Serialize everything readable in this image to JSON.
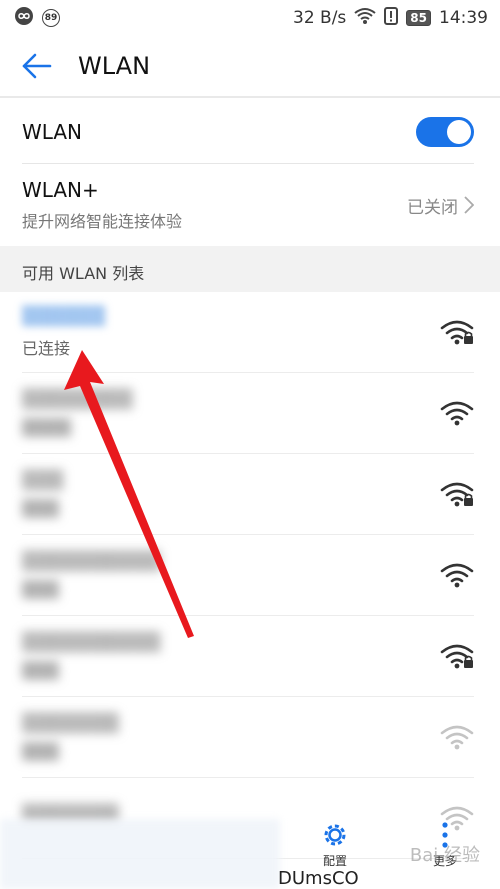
{
  "status_bar": {
    "badge_left": "89",
    "net_speed": "32 B/s",
    "battery": "85",
    "time": "14:39"
  },
  "header": {
    "title": "WLAN"
  },
  "wlan_toggle": {
    "label": "WLAN",
    "enabled": true
  },
  "wlan_plus": {
    "title": "WLAN+",
    "subtitle": "提升网络智能连接体验",
    "status": "已关闭"
  },
  "section_title": "可用 WLAN 列表",
  "networks": [
    {
      "name": "▒▒▒▒▒▒",
      "status": "已连接",
      "locked": true,
      "strength": "full"
    },
    {
      "name": "▒▒▒▒▒▒▒▒",
      "status": "▒▒▒▒",
      "locked": false,
      "strength": "full"
    },
    {
      "name": "▒▒▒",
      "status": "▒▒▒",
      "locked": true,
      "strength": "full"
    },
    {
      "name": "▒▒▒▒▒▒▒▒▒▒",
      "status": "▒▒▒",
      "locked": false,
      "strength": "full"
    },
    {
      "name": "▒▒▒▒▒▒▒▒▒▒",
      "status": "▒▒▒",
      "locked": true,
      "strength": "full"
    },
    {
      "name": "▒▒▒▒▒▒▒",
      "status": "▒▒▒",
      "locked": false,
      "strength": "weak"
    },
    {
      "name": "▒▒▒▒▒▒▒",
      "status": "",
      "locked": false,
      "strength": "weak"
    }
  ],
  "bottom_bar": {
    "config_label": "配置",
    "more_label": "更多"
  },
  "bottom_text": "DUmsCO",
  "watermark": "Bai 经验",
  "colors": {
    "accent": "#1a73e8",
    "arrow": "#e8191e"
  }
}
